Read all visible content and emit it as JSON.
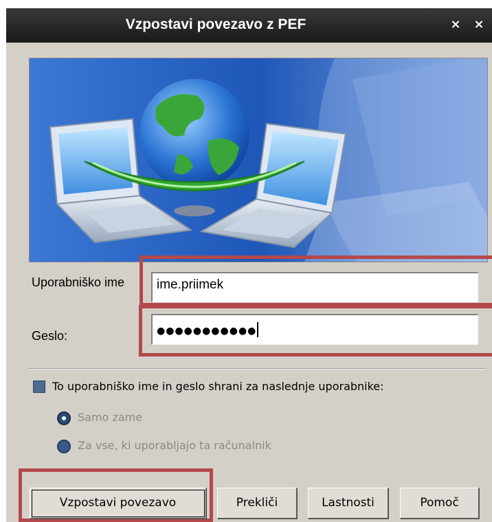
{
  "window": {
    "title": "Vzpostavi povezavo z PEF",
    "btn_1": "×",
    "btn_2": "×"
  },
  "form": {
    "username_label": "Uporabniško ime",
    "username_value": "ime.priimek",
    "password_label": "Geslo:",
    "password_mask": "●●●●●●●●●●●"
  },
  "save": {
    "checkbox_label": "To uporabniško ime in geslo shrani za naslednje uporabnike:",
    "option_only_me": "Samo zame",
    "option_everyone": "Za vse, ki uporabljajo ta računalnik"
  },
  "buttons": {
    "connect": "Vzpostavi povezavo",
    "cancel": "Prekliči",
    "properties": "Lastnosti",
    "help": "Pomoč"
  },
  "colors": {
    "highlight": "#b5484a",
    "titlebar": "#222222",
    "dialog_bg": "#d4d0c8"
  },
  "icons": {
    "banner": "network-globe-laptops-icon",
    "checkbox": "checkbox-icon",
    "radio": "radio-icon"
  }
}
